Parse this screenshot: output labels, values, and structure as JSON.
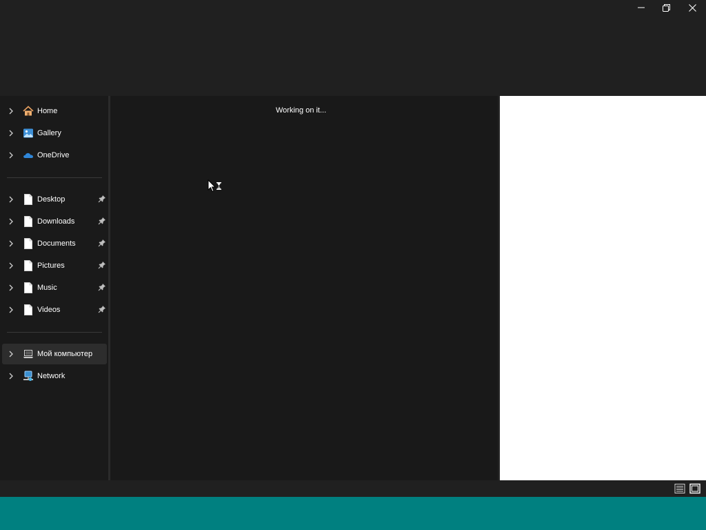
{
  "window": {
    "controls": {
      "minimize_icon": "minimize-icon",
      "maximize_icon": "restore-icon",
      "close_icon": "close-icon"
    }
  },
  "sidebar": {
    "quick": [
      {
        "label": "Home",
        "icon": "home-icon"
      },
      {
        "label": "Gallery",
        "icon": "gallery-icon"
      },
      {
        "label": "OneDrive",
        "icon": "onedrive-icon"
      }
    ],
    "pinned": [
      {
        "label": "Desktop",
        "icon": "document-icon",
        "pinned": true
      },
      {
        "label": "Downloads",
        "icon": "document-icon",
        "pinned": true
      },
      {
        "label": "Documents",
        "icon": "document-icon",
        "pinned": true
      },
      {
        "label": "Pictures",
        "icon": "document-icon",
        "pinned": true
      },
      {
        "label": "Music",
        "icon": "document-icon",
        "pinned": true
      },
      {
        "label": "Videos",
        "icon": "document-icon",
        "pinned": true
      }
    ],
    "devices": [
      {
        "label": "Мой компьютер",
        "icon": "computer-icon",
        "selected": true
      },
      {
        "label": "Network",
        "icon": "network-icon"
      }
    ]
  },
  "content": {
    "status_message": "Working on it..."
  },
  "statusbar": {
    "views": [
      "details-view-icon",
      "tiles-view-icon"
    ]
  },
  "colors": {
    "window_bg": "#202020",
    "nav_bg": "#1a1a1a",
    "content_bg": "#191919",
    "preview_bg": "#ffffff",
    "desktop_bg": "#008080",
    "selected_bg": "#2d2d2d"
  }
}
